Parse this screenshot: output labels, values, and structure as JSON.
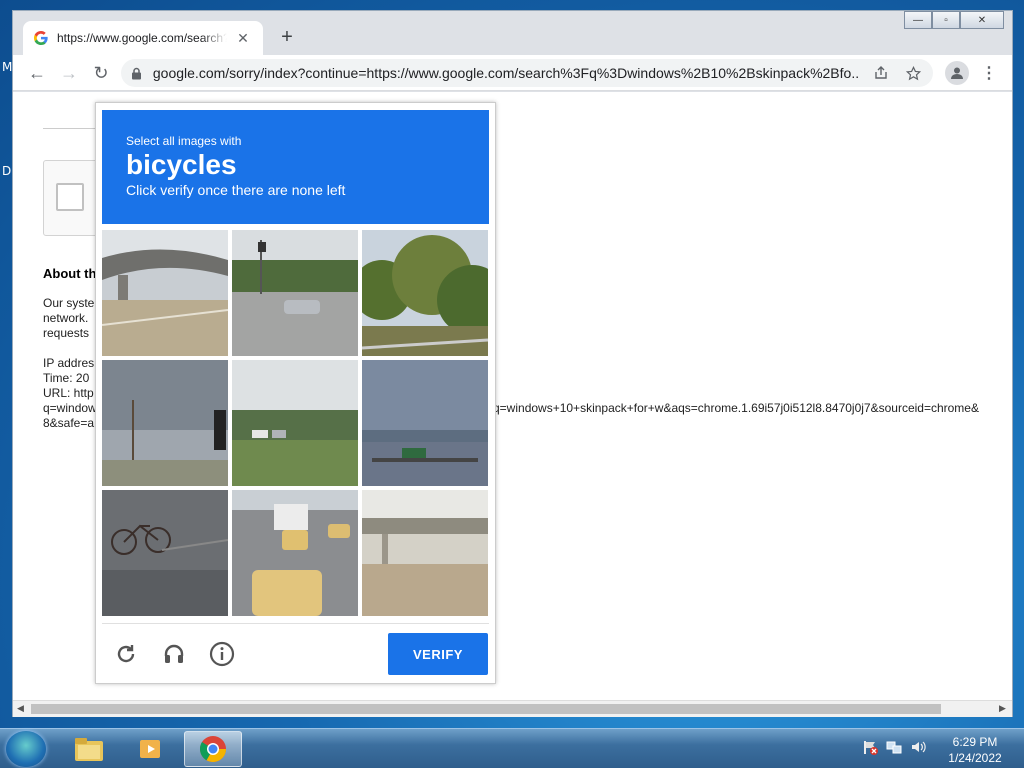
{
  "desktop": {
    "glyph_top": "M",
    "glyph_mid": "D"
  },
  "browser": {
    "tab": {
      "title": "https://www.google.com/search?q=",
      "close": "✕"
    },
    "new_tab": "+",
    "window_controls": {
      "minimize": "—",
      "maximize": "▫",
      "close": "✕"
    },
    "toolbar": {
      "back": "←",
      "forward": "→",
      "reload": "↻",
      "url": "google.com/sorry/index?continue=https://www.google.com/search%3Fq%3Dwindows%2B10%2Bskinpack%2Bfo..."
    }
  },
  "page": {
    "about_title": "About th",
    "body_lines": [
      "Our syste",
      "network.",
      "requests"
    ],
    "meta_lines": [
      "IP addres",
      "Time: 20",
      "URL: http",
      "q=window",
      "8&safe=a"
    ],
    "url_tail": "q=windows+10+skinpack+for+w&aqs=chrome.1.69i57j0i512l8.8470j0j7&sourceid=chrome&"
  },
  "captcha": {
    "prompt_line": "Select all images with",
    "target": "bicycles",
    "instruction": "Click verify once there are none left",
    "verify_label": "VERIFY",
    "accent": "#1a73e8",
    "tiles": [
      {
        "subject": "overpass"
      },
      {
        "subject": "road-car"
      },
      {
        "subject": "trees"
      },
      {
        "subject": "road-sky"
      },
      {
        "subject": "parking-lot"
      },
      {
        "subject": "highway-sign"
      },
      {
        "subject": "bicycle"
      },
      {
        "subject": "taxis"
      },
      {
        "subject": "overpass-wide"
      }
    ]
  },
  "taskbar": {
    "time": "6:29 PM",
    "date": "1/24/2022"
  }
}
